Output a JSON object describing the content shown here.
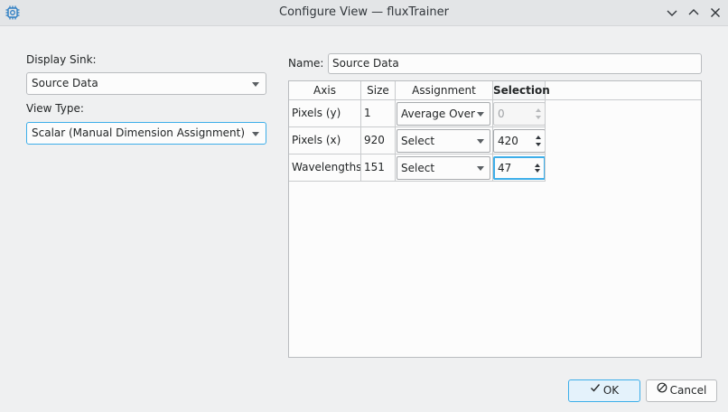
{
  "window": {
    "title": "Configure View — fluxTrainer",
    "app_icon": "gear-chip-icon",
    "controls": [
      "minimize-icon",
      "maximize-icon",
      "close-icon"
    ]
  },
  "left_panel": {
    "display_sink_label": "Display Sink:",
    "display_sink_value": "Source Data",
    "view_type_label": "View Type:",
    "view_type_value": "Scalar (Manual Dimension Assignment)"
  },
  "name_field": {
    "label": "Name:",
    "value": "Source Data"
  },
  "table": {
    "headers": [
      "Axis",
      "Size",
      "Assignment",
      "Selection"
    ],
    "rows": [
      {
        "axis": "Pixels (y)",
        "size": "1",
        "assignment": "Average Over",
        "selection": "0",
        "selection_enabled": false
      },
      {
        "axis": "Pixels (x)",
        "size": "920",
        "assignment": "Select",
        "selection": "420",
        "selection_enabled": true
      },
      {
        "axis": "Wavelengths",
        "size": "151",
        "assignment": "Select",
        "selection": "47",
        "selection_enabled": true
      }
    ]
  },
  "buttons": {
    "ok_label": "OK",
    "cancel_label": "Cancel"
  },
  "colors": {
    "accent": "#3daee9",
    "background": "#eff0f1",
    "titlebar": "#e3e5e7"
  }
}
